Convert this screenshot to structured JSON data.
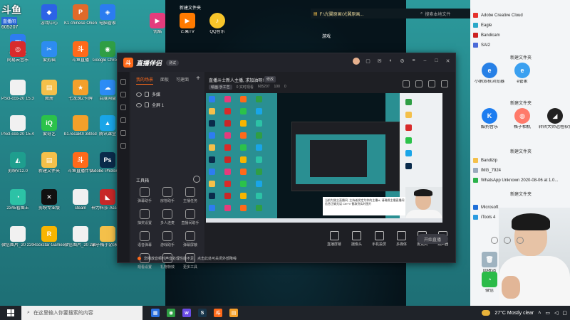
{
  "corner_logo": {
    "text": "斗鱼",
    "sub": "直播间",
    "room": "605207"
  },
  "desktop_icons": [
    {
      "label": "软件管理",
      "color": "#2d7df0",
      "glyph": "▣"
    },
    {
      "label": "游戏中心",
      "color": "#2c63e6",
      "glyph": "◆"
    },
    {
      "label": "K1 chinese Orientation...",
      "color": "#e06a2a",
      "glyph": "P"
    },
    {
      "label": "电脑管家",
      "color": "#2b7cf0",
      "glyph": "◈"
    },
    {
      "label": "网易云音乐",
      "color": "#d82b2b",
      "glyph": "◎"
    },
    {
      "label": "爱剪辑",
      "color": "#2d8cf0",
      "glyph": "✂"
    },
    {
      "label": "斗鱼直播",
      "color": "#ff6a1a",
      "glyph": "斗"
    },
    {
      "label": "Google Chrome",
      "color": "#2f9e44",
      "glyph": "◉"
    },
    {
      "label": "PScl-cco-20 15.3.......编...",
      "color": "#f1f1f1",
      "glyph": ""
    },
    {
      "label": "图册",
      "color": "#f4c04a",
      "glyph": "▤"
    },
    {
      "label": "七龙珠Z卡牌",
      "color": "#f4a02a",
      "glyph": "★"
    },
    {
      "label": "百度网盘",
      "color": "#2c8cf5",
      "glyph": "☁"
    },
    {
      "label": "PScl-cco-20 15.4......编...",
      "color": "#f1f1f1",
      "glyph": ""
    },
    {
      "label": "爱奇艺",
      "color": "#2bc24a",
      "glyph": "iQ"
    },
    {
      "label": "b17eca80l 380cd7ece...",
      "color": "#f4a02a",
      "glyph": ""
    },
    {
      "label": "腾讯课堂",
      "color": "#19a5e8",
      "glyph": "▲"
    },
    {
      "label": "剪映V12.0",
      "color": "#1e9e8e",
      "glyph": "◭"
    },
    {
      "label": "新建文件夹",
      "color": "#f4c04a",
      "glyph": "▤"
    },
    {
      "label": "斗鱼直播伴侣",
      "color": "#ff6a1a",
      "glyph": "斗"
    },
    {
      "label": "Adobe Photoshop CC 2...",
      "color": "#0a2b4b",
      "glyph": "Ps"
    },
    {
      "label": "2345看图王",
      "color": "#2cc2a6",
      "glyph": "◔"
    },
    {
      "label": "剪映专业版",
      "color": "#111111",
      "glyph": "✕"
    },
    {
      "label": "steam",
      "color": "#f1f1f1",
      "glyph": ""
    },
    {
      "label": "神力科莎 Assetto Corsa",
      "color": "#c82828",
      "glyph": "◣"
    },
    {
      "label": "微信图片_20 2201112...",
      "color": "#f1f1f1",
      "glyph": ""
    },
    {
      "label": "Rockstar Games Launc...",
      "color": "#f7b500",
      "glyph": "R"
    },
    {
      "label": "微信图片_20 2201112...",
      "color": "#f1f1f1",
      "glyph": ""
    },
    {
      "label": "录子橘小游泳 (1)",
      "color": "#f4c04a",
      "glyph": ""
    }
  ],
  "top_apps": [
    {
      "label": "优酷",
      "color": "#e43c7c",
      "glyph": "▶"
    },
    {
      "label": "芒果TV",
      "color": "#ff7a00",
      "glyph": "▶"
    },
    {
      "label": "QQ音乐",
      "color": "#f7c52a",
      "glyph": "♪"
    }
  ],
  "folder_labels": [
    "新建文件夹",
    "游戏"
  ],
  "explorer": {
    "path": "F:\\光翼原画\\光翼原画...",
    "search_placeholder": "搜索本地文件"
  },
  "right_panel": {
    "apps": [
      "Adobe Creative Cloud",
      "Eagle",
      "Bandicam",
      "SAI2"
    ],
    "folder_1": "新建文件夹",
    "icons_1": [
      {
        "label": "小鹅双核浏览器",
        "color": "#2780e6",
        "glyph": "e"
      },
      {
        "label": "e管家",
        "color": "#3aa0f0",
        "glyph": "e"
      }
    ],
    "folder_2": "新建文件夹",
    "icons_2": [
      {
        "label": "酷狗音乐",
        "color": "#1d7df0",
        "glyph": "K"
      },
      {
        "label": "格子相机",
        "color": "#ff7a6a",
        "glyph": "◍"
      },
      {
        "label": "转转大师远程软件",
        "color": "#222222",
        "glyph": "◢"
      }
    ],
    "folder_3": "新建文件夹",
    "rows": [
      "Bandizip",
      "IMG_7924",
      "WhatsApp Unknown 2020-08-06 at 1.0..."
    ],
    "folder_4": "新建文件夹",
    "extra": [
      "Microsoft...",
      "iTools 4"
    ],
    "bottom": [
      "回收站",
      "微信"
    ]
  },
  "app": {
    "name": "直播伴侣",
    "version_badge": "测试",
    "tabs": [
      "我的场景",
      "面板",
      "可建面"
    ],
    "layers": [
      "多媒",
      "全屏 1"
    ],
    "tools_header": "工具箱",
    "tools": [
      "弹幕助手",
      "房管助手",
      "主播任务",
      "抽奖设置",
      "多人连麦",
      "直播间助手",
      "语音弹幕",
      "游戏助手",
      "弹幕屏蔽",
      "观看设置",
      "礼物特效",
      "更多工具"
    ],
    "room_title": "直播斗士新人主播, 求加油呀!",
    "edit_label": "修改",
    "category": "绘画·手工艺",
    "room_stats": [
      "0 实时观看",
      "605207",
      "100",
      "0"
    ],
    "controls": [
      "直播屏幕",
      "摄像头",
      "手机投屏",
      "多媒体",
      "麦克风",
      "扬声器"
    ],
    "start_button": "开始直播",
    "warning": "您播放音频时声音处理性能不足，点击此处可关闭外部降噪",
    "preview_note": "当前为独立直播间, 主持者发定为你的主播id, 请确保主播直播间信息正确无误 Ctrl+V 截取到实时图片"
  },
  "taskbar": {
    "search_placeholder": "在这里输入你要搜索的内容",
    "apps": [
      {
        "color": "#2a6fe0",
        "glyph": "▦"
      },
      {
        "color": "#2f9e44",
        "glyph": "◉"
      },
      {
        "color": "#6a4ce6",
        "glyph": "w"
      },
      {
        "color": "#18354a",
        "glyph": "S"
      },
      {
        "color": "#ff6a1a",
        "glyph": "斗"
      },
      {
        "color": "#f4a02a",
        "glyph": "▤"
      }
    ],
    "weather": "27°C  Mostly clear"
  }
}
